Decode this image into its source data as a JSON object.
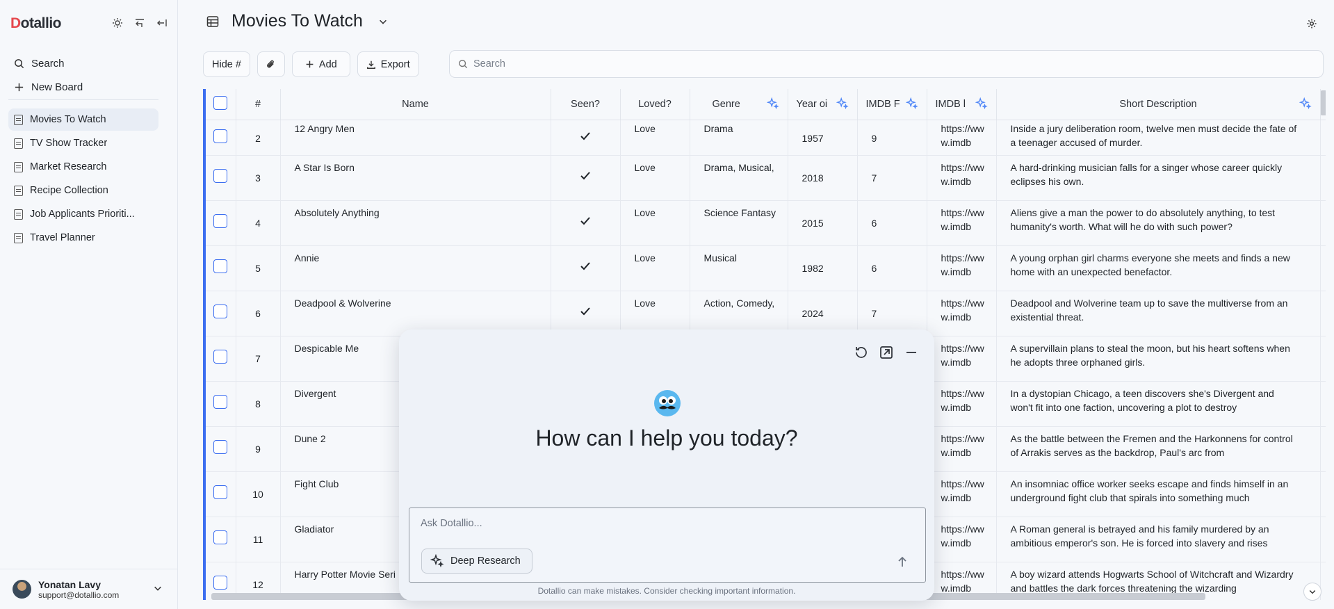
{
  "app": {
    "logo_d": "D",
    "logo_rest": "otallio"
  },
  "sidebar": {
    "menu": [
      {
        "label": "Search",
        "icon": "search-icon"
      },
      {
        "label": "New Board",
        "icon": "plus-icon"
      }
    ],
    "boards": [
      {
        "label": "Movies To Watch",
        "active": true
      },
      {
        "label": "TV Show Tracker"
      },
      {
        "label": "Market Research"
      },
      {
        "label": "Recipe Collection"
      },
      {
        "label": "Job Applicants Prioriti..."
      },
      {
        "label": "Travel Planner"
      }
    ],
    "user": {
      "name": "Yonatan Lavy",
      "email": "support@dotallio.com"
    }
  },
  "header": {
    "title": "Movies To Watch"
  },
  "toolbar": {
    "hide_label": "Hide #",
    "add_label": "Add",
    "export_label": "Export",
    "search_placeholder": "Search"
  },
  "table": {
    "columns": [
      "#",
      "Name",
      "Seen?",
      "Loved?",
      "Genre",
      "Year oi",
      "IMDB F",
      "IMDB l",
      "Short Description"
    ],
    "rows": [
      {
        "num": "2",
        "name": "12 Angry Men",
        "loved": "Love",
        "genre": "Drama",
        "year": "1957",
        "rating": "9",
        "imdb": "https://www.imdb",
        "desc": "Inside a jury deliberation room, twelve men must decide the fate of a teenager accused of murder."
      },
      {
        "num": "3",
        "name": "A Star Is Born",
        "loved": "Love",
        "genre": "Drama, Musical,",
        "year": "2018",
        "rating": "7",
        "imdb": "https://www.imdb",
        "desc": "A hard-drinking musician falls for a singer whose career quickly eclipses his own."
      },
      {
        "num": "4",
        "name": "Absolutely Anything",
        "loved": "Love",
        "genre": "Science Fantasy",
        "year": "2015",
        "rating": "6",
        "imdb": "https://www.imdb",
        "desc": "Aliens give a man the power to do absolutely anything, to test humanity's worth. What will he do with such power?"
      },
      {
        "num": "5",
        "name": "Annie",
        "loved": "Love",
        "genre": "Musical",
        "year": "1982",
        "rating": "6",
        "imdb": "https://www.imdb",
        "desc": "A young orphan girl charms everyone she meets and finds a new home with an unexpected benefactor."
      },
      {
        "num": "6",
        "name": "Deadpool & Wolverine",
        "loved": "Love",
        "genre": "Action, Comedy,",
        "year": "2024",
        "rating": "7",
        "imdb": "https://www.imdb",
        "desc": "Deadpool and Wolverine team up to save the multiverse from an existential threat."
      },
      {
        "num": "7",
        "name": "Despicable Me",
        "loved": "",
        "genre": "",
        "year": "",
        "rating": "",
        "imdb": "https://www.imdb",
        "desc": "A supervillain plans to steal the moon, but his heart softens when he adopts three orphaned girls."
      },
      {
        "num": "8",
        "name": "Divergent",
        "loved": "",
        "genre": "",
        "year": "",
        "rating": "",
        "imdb": "https://www.imdb",
        "desc": "In a dystopian Chicago, a teen discovers she's Divergent and won't fit into one faction, uncovering a plot to destroy"
      },
      {
        "num": "9",
        "name": "Dune 2",
        "loved": "",
        "genre": "",
        "year": "",
        "rating": "",
        "imdb": "https://www.imdb",
        "desc": "As the battle between the Fremen and the Harkonnens for control of Arrakis serves as the backdrop, Paul's arc from"
      },
      {
        "num": "10",
        "name": "Fight Club",
        "loved": "",
        "genre": "",
        "year": "",
        "rating": "",
        "imdb": "https://www.imdb",
        "desc": "An insomniac office worker seeks escape and finds himself in an underground fight club that spirals into something much"
      },
      {
        "num": "11",
        "name": "Gladiator",
        "loved": "",
        "genre": "",
        "year": "",
        "rating": "",
        "imdb": "https://www.imdb",
        "desc": "A Roman general is betrayed and his family murdered by an ambitious emperor's son. He is forced into slavery and rises"
      },
      {
        "num": "12",
        "name": "Harry Potter Movie Seri",
        "loved": "",
        "genre": "",
        "year": "",
        "rating": "",
        "imdb": "https://www.imdb",
        "desc": "A boy wizard attends Hogwarts School of Witchcraft and Wizardry and battles the dark forces threatening the wizarding"
      }
    ]
  },
  "chat": {
    "title": "How can I help you today?",
    "input_placeholder": "Ask Dotallio...",
    "deep_research_label": "Deep Research",
    "disclaimer": "Dotallio can make mistakes. Consider checking important information."
  },
  "colors": {
    "accent": "#3c6ef0",
    "sparkle": "#4f86f7",
    "logo": "#e5484d"
  }
}
